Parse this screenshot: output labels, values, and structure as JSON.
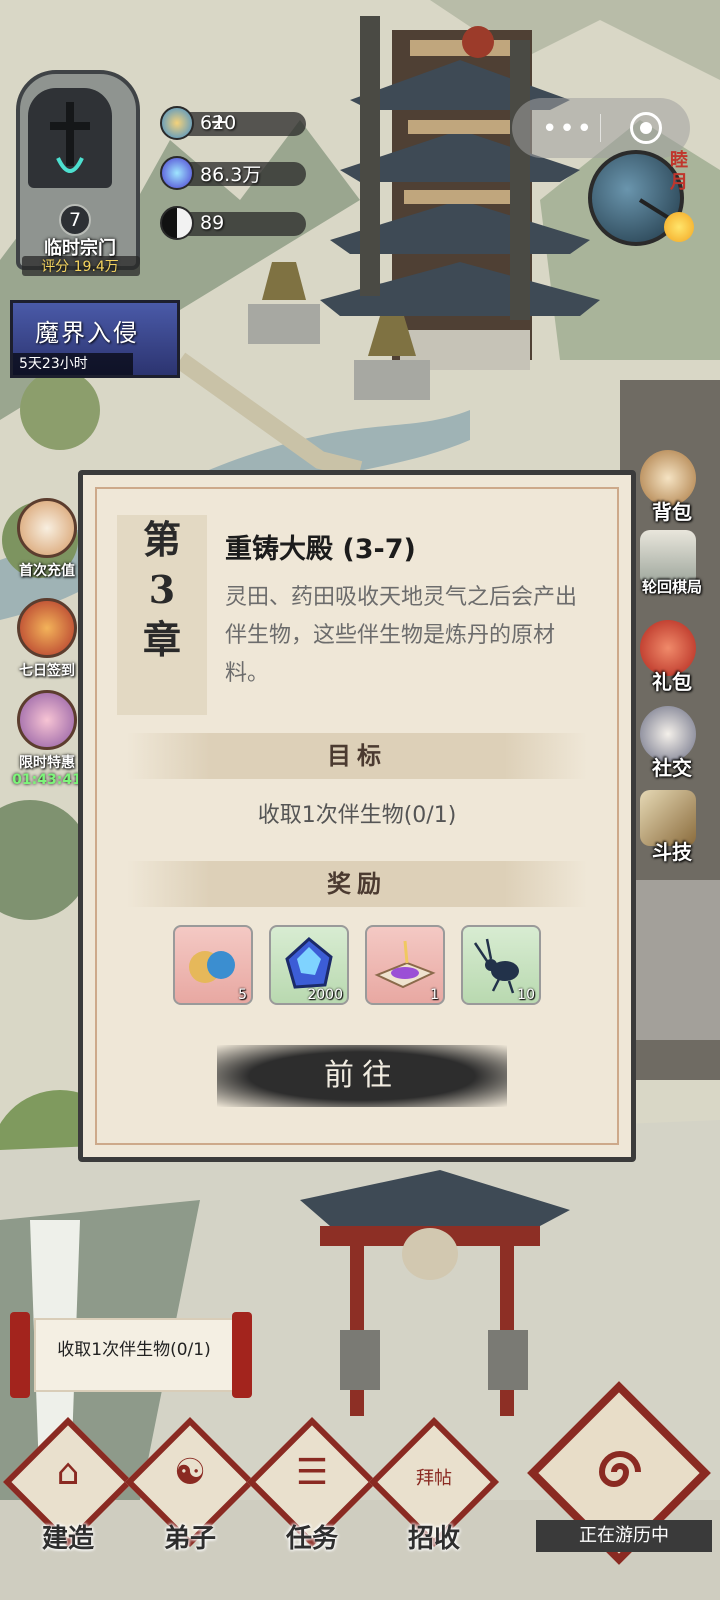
{
  "sect": {
    "level": "7",
    "name": "临时宗门",
    "score": "评分 19.4万"
  },
  "resources": [
    {
      "icon": "cloud-token-icon",
      "value": "620",
      "plus": "+"
    },
    {
      "icon": "spirit-stone-icon",
      "value": "86.3万"
    },
    {
      "icon": "yin-yang-icon",
      "value": "89"
    }
  ],
  "event": {
    "title": "魔界入侵",
    "timer": "5天23小时"
  },
  "clock": {
    "label": "睦月"
  },
  "left_side": [
    {
      "label": "首次充值"
    },
    {
      "label": "七日签到"
    },
    {
      "label": "限时特惠",
      "timer": "01:43:41"
    }
  ],
  "right_side": [
    {
      "label": "背包"
    },
    {
      "label": "轮回棋局"
    },
    {
      "label": "礼包"
    },
    {
      "label": "社交"
    },
    {
      "label": "斗技"
    }
  ],
  "dialog": {
    "chapter_chars": [
      "第",
      "3",
      "章"
    ],
    "title": "重铸大殿 (3-7)",
    "description": "灵田、药田吸收天地灵气之后会产出伴生物，这些伴生物是炼丹的原材料。",
    "goal_header": "目标",
    "goal_text": "收取1次伴生物(0/1)",
    "reward_header": "奖励",
    "rewards": [
      {
        "icon": "cloud-token-icon",
        "qty": "5"
      },
      {
        "icon": "spirit-stone-icon",
        "qty": "2000"
      },
      {
        "icon": "purple-scroll-icon",
        "qty": "1"
      },
      {
        "icon": "beetle-icon",
        "qty": "10"
      }
    ],
    "go_label": "前往"
  },
  "quest": {
    "text": "收取1次伴生物(0/1)"
  },
  "nav": [
    {
      "label": "建造"
    },
    {
      "label": "弟子"
    },
    {
      "label": "任务"
    },
    {
      "label": "招收",
      "card_text": "拜帖"
    },
    {
      "label": "正在游历中"
    }
  ],
  "colors": {
    "accent_red": "#8a2a22",
    "paper": "#efe7d7",
    "timer_green": "#7df57a",
    "score_gold": "#f4d35e"
  }
}
